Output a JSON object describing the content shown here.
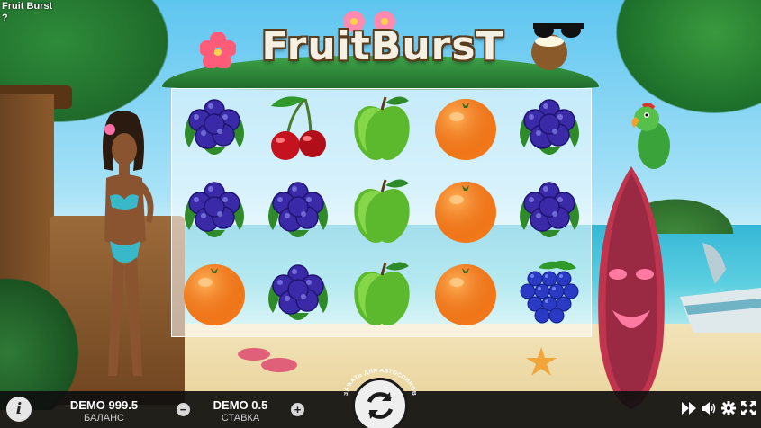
{
  "window": {
    "title": "Fruit Burst",
    "help": "?"
  },
  "logo": {
    "text": "FruitBursT"
  },
  "reels": [
    [
      "blueberries",
      "cherries",
      "apple",
      "orange",
      "blueberries"
    ],
    [
      "blueberries",
      "blueberries",
      "apple",
      "orange",
      "blueberries"
    ],
    [
      "orange",
      "blueberries",
      "apple",
      "orange",
      "grapes"
    ]
  ],
  "balance": {
    "value": "DEMO 999.5",
    "label": "БАЛАНС"
  },
  "bet": {
    "value": "DEMO 0.5",
    "label": "СТАВКА"
  },
  "bet_decrease": {
    "label": "−"
  },
  "bet_increase": {
    "label": "+"
  },
  "spin": {
    "hold_hint": "ЗАЖАТЬ ДЛЯ АВТОСПИНОВ",
    "icon": "spin-arrows-icon"
  },
  "info": {
    "label": "i"
  },
  "toolbar": {
    "icons": [
      "fast-forward-icon",
      "sound-icon",
      "settings-icon",
      "fullscreen-icon"
    ]
  },
  "colors": {
    "bar_bg": "#0f0f0f",
    "reel_bg": "#ffffff",
    "logo_text": "#f4f0e4",
    "accent_green": "#3fa34a"
  }
}
